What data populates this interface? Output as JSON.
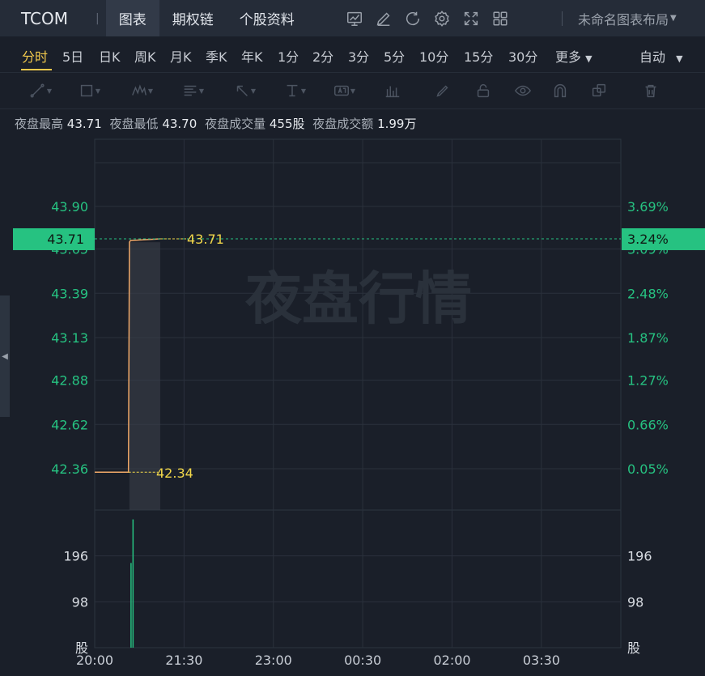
{
  "header": {
    "symbol": "TCOM",
    "separator": "|",
    "tabs": [
      {
        "label": "图表",
        "active": true
      },
      {
        "label": "期权链",
        "active": false
      },
      {
        "label": "个股资料",
        "active": false
      }
    ],
    "icons": [
      "chart-line-icon",
      "pencil-icon",
      "refresh-icon",
      "gear-icon",
      "fullscreen-icon",
      "grid-icon"
    ],
    "layout_label": "未命名图表布局"
  },
  "periods": {
    "items": [
      "分时",
      "5日",
      "日K",
      "周K",
      "月K",
      "季K",
      "年K",
      "1分",
      "2分",
      "3分",
      "5分",
      "10分",
      "15分",
      "30分",
      "更多"
    ],
    "active": "分时",
    "auto_label": "自动"
  },
  "toolbar": {
    "icons": [
      "trend-line-icon",
      "rectangle-icon",
      "pattern-icon",
      "fib-icon",
      "arrow-icon",
      "measure-icon",
      "text-icon",
      "indicator-icon",
      "brush-icon",
      "lock-icon",
      "eye-icon",
      "magnet-icon",
      "layers-icon",
      "trash-icon"
    ]
  },
  "stats": [
    {
      "label": "夜盘最高",
      "value": "43.71"
    },
    {
      "label": "夜盘最低",
      "value": "43.70"
    },
    {
      "label": "夜盘成交量",
      "value": "455股"
    },
    {
      "label": "夜盘成交额",
      "value": "1.99万"
    }
  ],
  "watermark": "夜盘行情",
  "colors": {
    "up": "#26c281",
    "price_line": "#f0a868",
    "label_yellow": "#f2d74a",
    "period_active": "#f2c94c"
  },
  "chart_data": {
    "type": "line",
    "price_ticks": [
      "43.90",
      "43.65",
      "43.39",
      "43.13",
      "42.88",
      "42.62",
      "42.36"
    ],
    "price_tick_values": [
      43.9,
      43.65,
      43.39,
      43.13,
      42.88,
      42.62,
      42.36
    ],
    "pct_ticks": [
      "3.69%",
      "3.09%",
      "2.48%",
      "1.87%",
      "1.27%",
      "0.66%",
      "0.05%"
    ],
    "price_ylim": [
      42.36,
      43.9
    ],
    "current_price": "43.71",
    "current_value": 43.71,
    "current_pct": "3.24%",
    "low_label": "42.34",
    "low_value": 42.34,
    "x_ticks": [
      "20:00",
      "21:30",
      "23:00",
      "00:30",
      "02:00",
      "03:30"
    ],
    "x_tick_minutes": [
      0,
      90,
      180,
      270,
      360,
      450
    ],
    "x_range_minutes": [
      0,
      530
    ],
    "series": [
      {
        "x_minutes": [
          0,
          34,
          35,
          36,
          66
        ],
        "values": [
          42.34,
          42.34,
          43.69,
          43.7,
          43.71
        ]
      }
    ],
    "volume_ticks": [
      "196",
      "98",
      "股"
    ],
    "volume_tick_values": [
      196,
      98,
      0
    ],
    "volume_ylim": [
      0,
      294
    ],
    "volume_bars": [
      {
        "x_minutes": 36,
        "value": 181
      },
      {
        "x_minutes": 38,
        "value": 274
      }
    ]
  }
}
